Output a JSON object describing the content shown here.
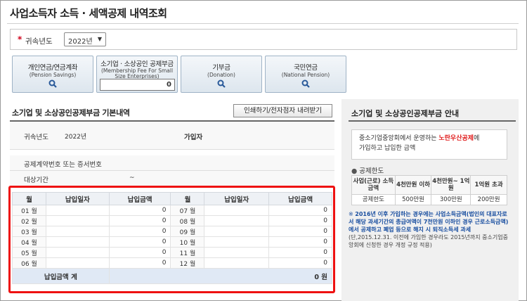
{
  "page": {
    "title": "사업소득자 소득 · 세액공제 내역조회"
  },
  "year_filter": {
    "required_mark": "*",
    "label": "귀속년도",
    "selected": "2022년"
  },
  "tiles": [
    {
      "title": "개인연금/연금계좌",
      "subtitle": "(Pension Savings)"
    },
    {
      "title": "소기업 · 소상공인 공제부금",
      "subtitle": "(Membership Fee For Small Size Enterprises)",
      "value": "0"
    },
    {
      "title": "기부금",
      "subtitle": "(Donation)"
    },
    {
      "title": "국민연금",
      "subtitle": "(National Pension)"
    }
  ],
  "left_section": {
    "title": "소기업 및 소상공인공제부금 기본내역",
    "print_button": "인쇄하기/전자점자 내려받기",
    "info": {
      "year_label": "귀속년도",
      "year_value": "2022년",
      "member_label": "가입자",
      "member_value": "",
      "contract_label": "공제계약번호 또는 증서번호",
      "contract_value": "",
      "period_label": "대상기간",
      "period_value": "~"
    }
  },
  "payments": {
    "headers": [
      "월",
      "납입일자",
      "납입금액",
      "월",
      "납입일자",
      "납입금액"
    ],
    "rows": [
      {
        "m1": "01 월",
        "d1": "",
        "a1": "0",
        "m2": "07 월",
        "d2": "",
        "a2": "0"
      },
      {
        "m1": "02 월",
        "d1": "",
        "a1": "0",
        "m2": "08 월",
        "d2": "",
        "a2": "0"
      },
      {
        "m1": "03 월",
        "d1": "",
        "a1": "0",
        "m2": "09 월",
        "d2": "",
        "a2": "0"
      },
      {
        "m1": "04 월",
        "d1": "",
        "a1": "0",
        "m2": "10 월",
        "d2": "",
        "a2": "0"
      },
      {
        "m1": "05 월",
        "d1": "",
        "a1": "0",
        "m2": "11 월",
        "d2": "",
        "a2": "0"
      },
      {
        "m1": "06 월",
        "d1": "",
        "a1": "0",
        "m2": "12 월",
        "d2": "",
        "a2": "0"
      }
    ],
    "total_label": "납입금액 계",
    "total_value": "0 원"
  },
  "right_panel": {
    "title": "소기업 및 소상공인공제부금 안내",
    "intro_pre": "중소기업중앙회에서 운영하는 ",
    "intro_highlight": "노란우산공제",
    "intro_post": "에",
    "intro_line2": "가입하고 납입한 금액",
    "limit_title": "공제한도",
    "limit_headers": [
      "사업(근로) 소득금액",
      "4천만원 이하",
      "4천만원~ 1억원",
      "1억원 초과"
    ],
    "limit_values": [
      "공제한도",
      "500만원",
      "300만원",
      "200만원"
    ],
    "note_mark": "※",
    "note_bold": "2016년 이후 가입하는 경우에는 사업소득금액(법인의 대표자로서 해당 과세기간의 총급여액이 7천만원 이하인 경우 근로소득금액)에서 공제하고 폐업 등으로 해지 시 퇴직소득세 과세",
    "note_gray": "(단,2015.12.31. 이전에 가입한 경우라도 2015년까지 중소기업중앙회에 신청한 경우 개정 규정 적용)"
  }
}
